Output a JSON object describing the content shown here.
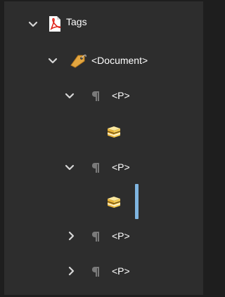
{
  "tree": {
    "root": {
      "label": "Tags",
      "expanded": true,
      "icon": "pdf-tags-icon"
    },
    "document": {
      "label": "<Document>",
      "expanded": true,
      "icon": "tag-icon"
    },
    "items": [
      {
        "label": "<P>",
        "expanded": true,
        "icon": "paragraph-icon",
        "child_icon": "content-box-icon"
      },
      {
        "label": "<P>",
        "expanded": true,
        "icon": "paragraph-icon",
        "child_icon": "content-box-icon"
      },
      {
        "label": "<P>",
        "expanded": false,
        "icon": "paragraph-icon"
      },
      {
        "label": "<P>",
        "expanded": false,
        "icon": "paragraph-icon"
      }
    ]
  },
  "colors": {
    "background": "#2d2d2d",
    "text": "#ffffff",
    "chevron": "#d6d6d6",
    "pdf_red": "#e0251b",
    "tag_gold": "#e3a640",
    "paragraph_gray": "#7a7a7a",
    "box_yellow": "#f2cc55",
    "selection": "#7fb5e0"
  }
}
